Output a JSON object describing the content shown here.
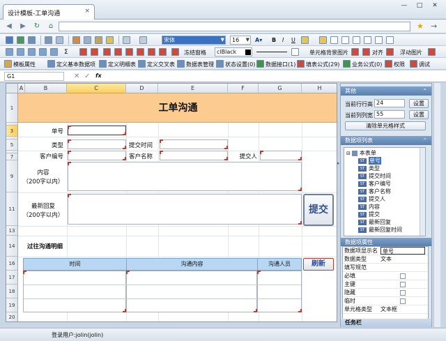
{
  "window": {
    "tab_title": "设计模板-工单沟通",
    "tab_close": "×",
    "min": "—",
    "max": "□",
    "close": "✕"
  },
  "address": {
    "url": "",
    "star": "★",
    "go": "→"
  },
  "toolbar1": {
    "font_name": "宋体",
    "font_size": "16",
    "bold": "B",
    "italic": "I",
    "underline": "U"
  },
  "toolbar2": {
    "sum": "Σ",
    "freeze": "冻结窗格",
    "color": "clBlack",
    "bg_image": "单元格背景图片",
    "align": "对齐",
    "float_image": "浮动图片"
  },
  "toolbar3": {
    "items": [
      "模板属性",
      "定义基本数据项",
      "定义明细表",
      "定义交叉表",
      "数据表管理",
      "状态设置(0)",
      "数据接口(1)",
      "填表公式(29)",
      "业务公式(0)",
      "权限",
      "调试"
    ]
  },
  "formula_bar": {
    "cell_ref": "G1",
    "fx": "fx",
    "content": ""
  },
  "sheet": {
    "columns": [
      "A",
      "B",
      "C",
      "D",
      "E",
      "F",
      "G",
      "H"
    ],
    "rows": [
      "1",
      "3",
      "5",
      "7",
      "9",
      "11",
      "13",
      "14",
      "16",
      "17",
      "18",
      "19",
      "20"
    ],
    "title": "工单沟通",
    "labels": {
      "order_no": "单号",
      "type": "类型",
      "submit_time": "提交时间",
      "customer_no": "客户编号",
      "customer_name": "客户名称",
      "submitter": "提交人",
      "content": "内容",
      "content_limit": "（200字以内）",
      "reply": "最新回复",
      "reply_limit": "（200字以内）",
      "history": "过往沟通明细"
    },
    "submit_button": "提交",
    "refresh_button": "刷新",
    "table_headers": [
      "时间",
      "沟通内容",
      "沟通人员"
    ]
  },
  "right_panel": {
    "other_title": "其他",
    "row_height_label": "当前行行高",
    "row_height": "24",
    "set1": "设置",
    "col_width_label": "当前列列宽",
    "col_width": "55",
    "set2": "设置",
    "clear_style": "清除单元格样式",
    "dataitems_title": "数据项列表",
    "tree_root": "本表单",
    "tree_items": [
      "单号",
      "类型",
      "提交时间",
      "客户编号",
      "客户名称",
      "提交人",
      "内容",
      "提交",
      "最新回复",
      "最新回复时间"
    ],
    "tag": "ST",
    "props_title": "数据项属性",
    "props": [
      {
        "k": "数据项显示名",
        "v": "单号",
        "cb": false
      },
      {
        "k": "数据类型",
        "v": "文本",
        "cb": false
      },
      {
        "k": "填写规范",
        "v": "",
        "cb": false
      },
      {
        "k": "必填",
        "v": "",
        "cb": true
      },
      {
        "k": "主键",
        "v": "",
        "cb": true
      },
      {
        "k": "隐藏",
        "v": "",
        "cb": true
      },
      {
        "k": "临时",
        "v": "",
        "cb": true
      },
      {
        "k": "单元格类型",
        "v": "文本框",
        "cb": false
      }
    ],
    "taskbar": "任务栏"
  },
  "status": {
    "user": "登录用户:jolin(jolin)"
  }
}
